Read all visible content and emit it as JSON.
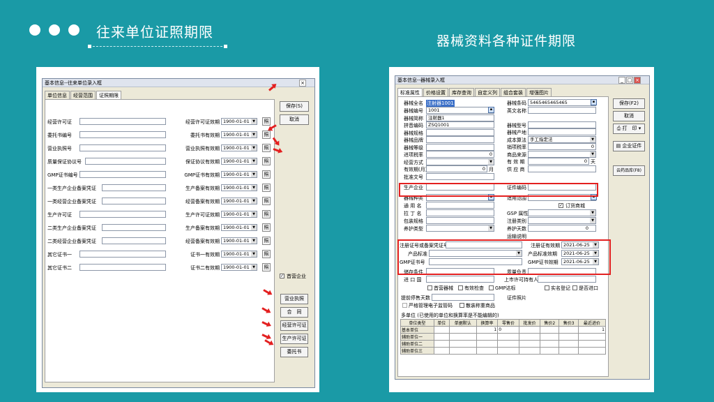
{
  "slide": {
    "title": "往来单位证照期限",
    "subtitle": "器械资料各种证件期限"
  },
  "win1": {
    "title": "基本信息--往来单位录入框",
    "tabs": [
      "单位信息",
      "经营范围",
      "证照期限"
    ],
    "left_labels": [
      "经营许可证",
      "委托书编号",
      "营业执照号",
      "质量保证协议号",
      "GMP证书编号",
      "一类生产企业备案凭证",
      "一类经营企业备案凭证",
      "生产许可证",
      "二类生产企业备案凭证",
      "二类经营企业备案凭证",
      "其它证书一",
      "其它证书二"
    ],
    "right_labels": [
      "经营许可证效期",
      "委托书有效期",
      "营业执照有效期",
      "保证协议有效期",
      "GMP证书有效期",
      "生产备案有效期",
      "经营备案有效期",
      "生产许可证效期",
      "生产备案有效期",
      "经营备案有效期",
      "证书一有效期",
      "证书二有效期"
    ],
    "date_value": "1900-01-01",
    "photo_label": "照",
    "save_label": "保存(S)",
    "cancel_label": "取消",
    "checkbox_label": "首营企业",
    "side_buttons": [
      "营业执照",
      "合　同",
      "经营许可证",
      "生产许可证",
      "委托书"
    ]
  },
  "win2": {
    "title": "基本信息--器械录入框",
    "tabs": [
      "标准属性",
      "价格设置",
      "库存查询",
      "自定义列",
      "组合套装",
      "增强图片"
    ],
    "labels": {
      "name": "器械全名",
      "name_value": "注射器1001",
      "code": "器械编号",
      "code_value": "1001",
      "alias": "器械简称",
      "alias_value": "注射器1",
      "pinyin": "拼音编码",
      "pinyin_value": "ZSQ1001",
      "spec": "器械规格",
      "brand": "器械品牌",
      "grade": "器械等级",
      "in_tax": "进项税率",
      "in_tax_value": "0",
      "mode": "经营方式",
      "validity": "有效期(月)",
      "validity_value": "0",
      "month": "月",
      "approval": "批准文号",
      "maker": "生产企业",
      "kind": "器械种类",
      "common": "通 用 名",
      "latin": "拉 丁 名",
      "package": "包装规格",
      "care": "养护类型",
      "barcode": "器械条码",
      "barcode_value": "5465465465465",
      "en_name": "英文名称",
      "model": "器械型号",
      "origin": "器械产地",
      "cost": "成本算法",
      "cost_value": "手工指定法",
      "out_tax": "销项税率",
      "out_tax_value": "0",
      "source": "商品来源",
      "valid_days": "有 效 期",
      "valid_days_value": "0",
      "day": "天",
      "supplier": "供 应 商",
      "cert_code": "证件编码",
      "scope": "适用范围",
      "goods": "订货商城",
      "gsp": "GSP 属性",
      "reg_category": "注册类别",
      "care_days": "养护天数",
      "care_days_value": "0",
      "ship": "运输说明",
      "reg_cert": "注册证号或备案凭证号",
      "reg_valid": "注册证有效期",
      "product_std": "产品标准",
      "std_valid": "产品标准效期",
      "gmp_cert": "GMP证书号",
      "gmp_valid": "GMP证书效期",
      "storage": "储存条件",
      "manager": "质量负责",
      "import": "进 口 国",
      "holder": "上市许可持有人",
      "first": "首营器械",
      "exam": "有效检查",
      "gmp_check": "GMP达标",
      "realname": "实名登记",
      "inquiry": "是否进口",
      "stop_days": "提前停售天数",
      "photo": "证件照片",
      "elec": "严格管理电子监管码",
      "pack_weigh": "散装称重商品",
      "multi": "多单位 (已使用的单位和换算率是不能编辑的)",
      "date_value": "2021-06-25"
    },
    "buttons": [
      "保存(F2)",
      "取消",
      "打　印",
      "企业证件",
      "云药品库(F8)"
    ],
    "grid_headers": [
      "单位类型",
      "单位",
      "单据默认",
      "换算率",
      "零售价",
      "批发价",
      "售价2",
      "售价3",
      "最近进价"
    ],
    "grid_rows": [
      {
        "type": "基本单位",
        "ratio": "1",
        "retail": "0",
        "last": "1"
      },
      {
        "type": "辅助单位一",
        "ratio": "",
        "retail": "",
        "last": ""
      },
      {
        "type": "辅助单位二",
        "ratio": "",
        "retail": "",
        "last": ""
      },
      {
        "type": "辅助单位三",
        "ratio": "",
        "retail": "",
        "last": ""
      }
    ]
  }
}
